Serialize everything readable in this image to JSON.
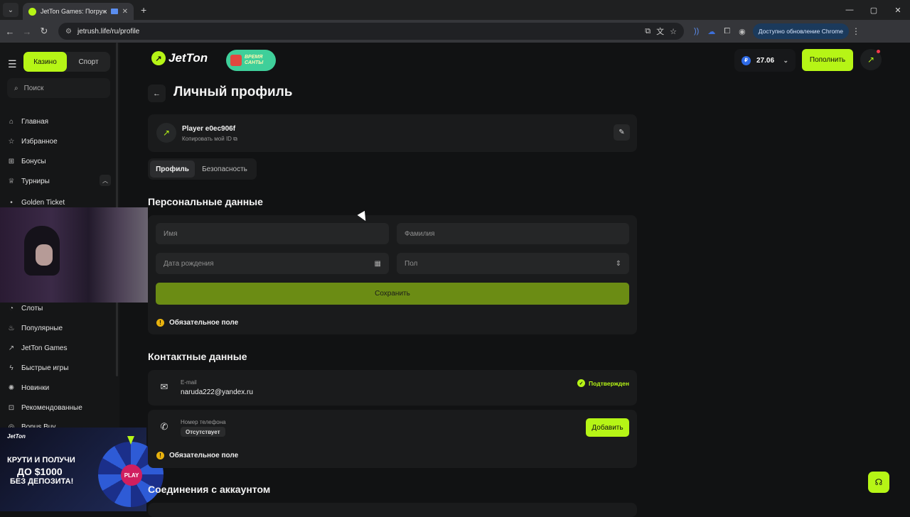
{
  "browser": {
    "tab_title": "JetTon Games: Погружени",
    "url": "jetrush.life/ru/profile",
    "update_label": "Доступно обновление Chrome"
  },
  "sidebar": {
    "tab_casino": "Казино",
    "tab_sport": "Спорт",
    "search_placeholder": "Поиск",
    "items": [
      {
        "label": "Главная",
        "icon": "home-icon"
      },
      {
        "label": "Избранное",
        "icon": "star-icon"
      },
      {
        "label": "Бонусы",
        "icon": "gift-icon"
      },
      {
        "label": "Турниры",
        "icon": "trophy-icon"
      },
      {
        "label": "Golden Ticket",
        "icon": "dot-icon"
      },
      {
        "label": "Слоты",
        "icon": "slots-icon"
      },
      {
        "label": "Популярные",
        "icon": "fire-icon"
      },
      {
        "label": "JetTon Games",
        "icon": "jetton-icon"
      },
      {
        "label": "Быстрые игры",
        "icon": "lightning-icon"
      },
      {
        "label": "Новинки",
        "icon": "new-icon"
      },
      {
        "label": "Рекомендованные",
        "icon": "recommended-icon"
      },
      {
        "label": "Bonus Buy",
        "icon": "bonus-buy-icon"
      }
    ]
  },
  "promo": {
    "logo": "JetTon",
    "line1": "КРУТИ И ПОЛУЧИ",
    "line2": "ДО $1000",
    "line3": "БЕЗ ДЕПОЗИТА!",
    "play": "PLAY"
  },
  "header": {
    "brand": "JetTon",
    "badge_line1": "ВРЕМЯ",
    "badge_line2": "САНТЫ",
    "balance": "27.06",
    "currency_symbol": "₽",
    "topup_label": "Пополнить"
  },
  "profile": {
    "title": "Личный профиль",
    "player_name": "Player e0ec906f",
    "copy_id_label": "Копировать мой ID",
    "tabs": [
      "Профиль",
      "Безопасность"
    ]
  },
  "personal": {
    "section_title": "Персональные данные",
    "first_name_placeholder": "Имя",
    "last_name_placeholder": "Фамилия",
    "birth_placeholder": "Дата рождения",
    "gender_placeholder": "Пол",
    "save_label": "Сохранить",
    "required_note": "Обязательное поле"
  },
  "contacts": {
    "section_title": "Контактные данные",
    "email_label": "E-mail",
    "email_value": "naruda222@yandex.ru",
    "email_status": "Подтвержден",
    "phone_label": "Номер телефона",
    "phone_value": "Отсутствует",
    "add_label": "Добавить",
    "required_note": "Обязательное поле"
  },
  "connections": {
    "section_title": "Соединения с аккаунтом"
  },
  "colors": {
    "accent": "#b6f516",
    "background": "#111213",
    "card": "#1a1b1c"
  }
}
